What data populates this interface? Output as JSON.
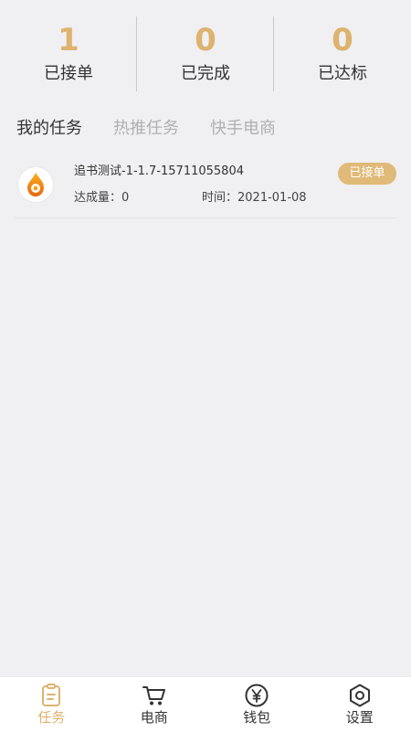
{
  "stats": [
    {
      "value": "1",
      "label": "已接单"
    },
    {
      "value": "0",
      "label": "已完成"
    },
    {
      "value": "0",
      "label": "已达标"
    }
  ],
  "tabs": [
    {
      "label": "我的任务",
      "active": true
    },
    {
      "label": "热推任务",
      "active": false
    },
    {
      "label": "快手电商",
      "active": false
    }
  ],
  "tasks": [
    {
      "title": "追书测试-1-1.7-15711055804",
      "count": "达成量：0",
      "time": "时间：2021-01-08",
      "status": "已接单",
      "logo_icon": "flame-logo-icon"
    }
  ],
  "bottom_nav": [
    {
      "label": "任务",
      "icon": "clipboard-icon",
      "active": true
    },
    {
      "label": "电商",
      "icon": "cart-icon",
      "active": false
    },
    {
      "label": "钱包",
      "icon": "yen-icon",
      "active": false
    },
    {
      "label": "设置",
      "icon": "hexagon-settings-icon",
      "active": false
    }
  ],
  "colors": {
    "accent": "#ddb36f",
    "background": "#f0eff1",
    "text": "#333333",
    "muted": "#b0afb1"
  }
}
